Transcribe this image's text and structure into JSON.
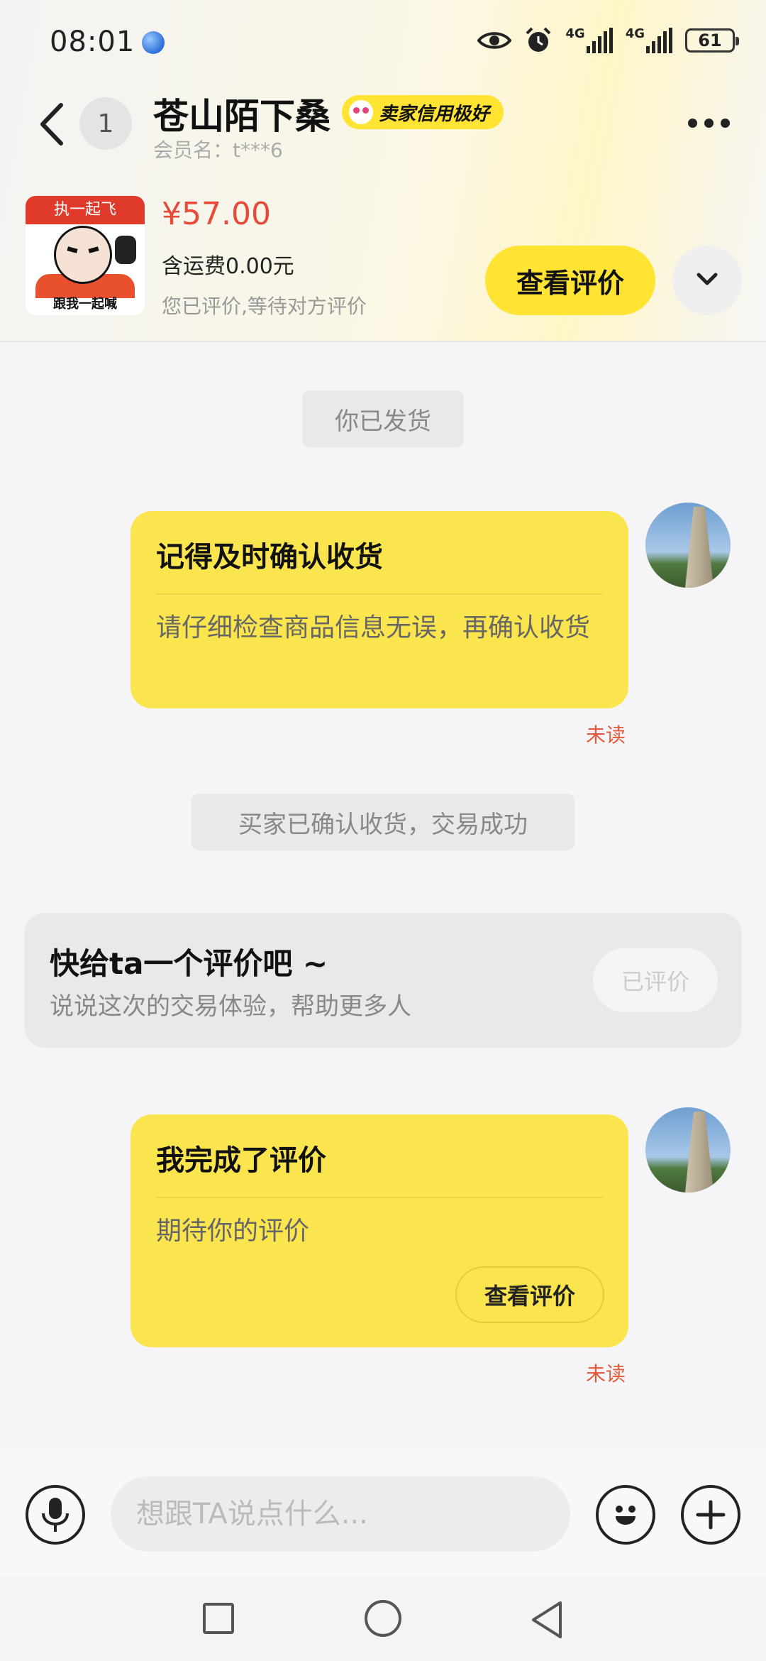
{
  "status_bar": {
    "time": "08:01",
    "network_1": "4G",
    "network_2": "4G",
    "battery": "61"
  },
  "header": {
    "unread_count": "1",
    "title": "苍山陌下桑",
    "credit_badge": "卖家信用极好",
    "member_name": "会员名：t***6"
  },
  "product": {
    "thumb_banner": "执一起飞",
    "thumb_caption": "跟我一起喊",
    "price": "¥57.00",
    "shipping": "含运费0.00元",
    "review_status": "您已评价,等待对方评价",
    "view_review_label": "查看评价"
  },
  "messages": {
    "system_1": "你已发货",
    "card_1": {
      "title": "记得及时确认收货",
      "body": "请仔细检查商品信息无误，再确认收货",
      "status": "未读"
    },
    "system_2": "买家已确认收货，交易成功",
    "review_prompt": {
      "title": "快给ta一个评价吧 ~",
      "subtitle": "说说这次的交易体验，帮助更多人",
      "button": "已评价"
    },
    "card_2": {
      "title": "我完成了评价",
      "body": "期待你的评价",
      "button": "查看评价",
      "status": "未读"
    }
  },
  "input_bar": {
    "placeholder": "想跟TA说点什么..."
  },
  "colors": {
    "accent_yellow": "#ffe433",
    "bubble_yellow": "#fbe54e",
    "price_red": "#e84a3a",
    "unread_red": "#e25a3c"
  }
}
